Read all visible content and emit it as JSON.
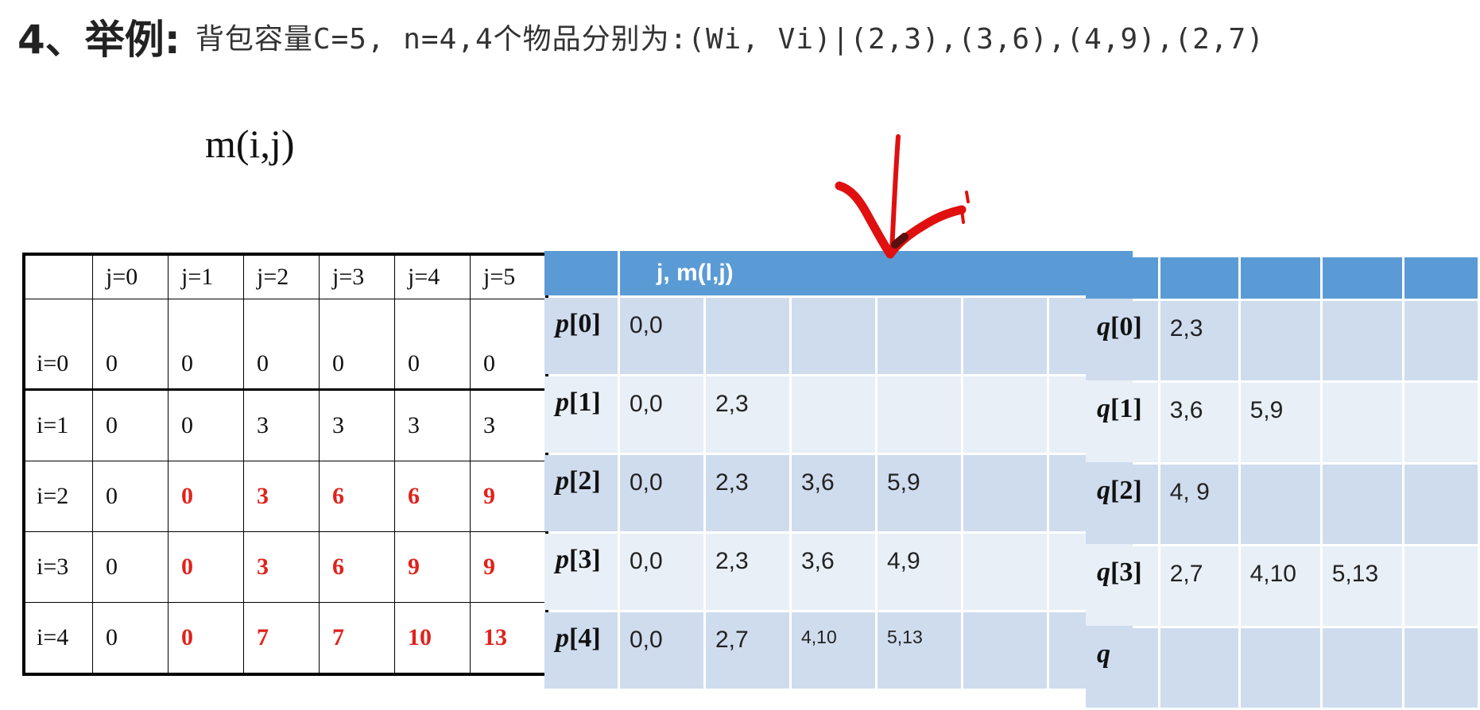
{
  "header": {
    "label": "4、举例:",
    "text": "背包容量C=5, n=4,4个物品分别为:(Wi, Vi)|(2,3),(3,6),(4,9),(2,7)"
  },
  "m_label": "m(i,j)",
  "m_table": {
    "columns": [
      "j=0",
      "j=1",
      "j=2",
      "j=3",
      "j=4",
      "j=5"
    ],
    "rows": [
      {
        "label": "i=0",
        "values": [
          "0",
          "0",
          "0",
          "0",
          "0",
          "0"
        ]
      },
      {
        "label": "i=1",
        "values": [
          "0",
          "0",
          "3",
          "3",
          "3",
          "3"
        ]
      },
      {
        "label": "i=2",
        "values": [
          "0",
          "0",
          "3",
          "6",
          "6",
          "9"
        ]
      },
      {
        "label": "i=3",
        "values": [
          "0",
          "0",
          "3",
          "6",
          "9",
          "9"
        ]
      },
      {
        "label": "i=4",
        "values": [
          "0",
          "0",
          "7",
          "7",
          "10",
          "13"
        ]
      }
    ],
    "highlight_color": "#e0221b"
  },
  "p_table": {
    "header": "j,   m(l,j)",
    "rows": [
      {
        "label_var": "p",
        "label_idx": "[0]",
        "cells": [
          "0,0",
          "",
          "",
          "",
          "",
          ""
        ]
      },
      {
        "label_var": "p",
        "label_idx": "[1]",
        "cells": [
          "0,0",
          "2,3",
          "",
          "",
          "",
          ""
        ]
      },
      {
        "label_var": "p",
        "label_idx": "[2]",
        "cells": [
          "0,0",
          "2,3",
          "3,6",
          "5,9",
          "",
          ""
        ]
      },
      {
        "label_var": "p",
        "label_idx": "[3]",
        "cells": [
          "0,0",
          "2,3",
          "3,6",
          "4,9",
          "",
          ""
        ]
      },
      {
        "label_var": "p",
        "label_idx": "[4]",
        "cells": [
          "0,0",
          "2,7",
          "4,10",
          "5,13",
          "",
          ""
        ]
      }
    ]
  },
  "q_table": {
    "rows": [
      {
        "label_var": "q",
        "label_idx": "[0]",
        "cells": [
          "2,3",
          "",
          "",
          ""
        ]
      },
      {
        "label_var": "q",
        "label_idx": "[1]",
        "cells": [
          "3,6",
          "5,9",
          "",
          ""
        ]
      },
      {
        "label_var": "q",
        "label_idx": "[2]",
        "cells": [
          "4, 9",
          "",
          "",
          ""
        ]
      },
      {
        "label_var": "q",
        "label_idx": "[3]",
        "cells": [
          "2,7",
          "4,10",
          "5,13",
          ""
        ]
      },
      {
        "label_var": "q",
        "label_idx": "",
        "cells": [
          "",
          "",
          "",
          ""
        ]
      }
    ]
  },
  "colors": {
    "blue_header": "#5b9bd5",
    "row_dark": "#cfdcee",
    "row_light": "#e9eff7",
    "ink_red": "#e01010"
  },
  "annotation": {
    "icon": "checkmark-icon"
  }
}
